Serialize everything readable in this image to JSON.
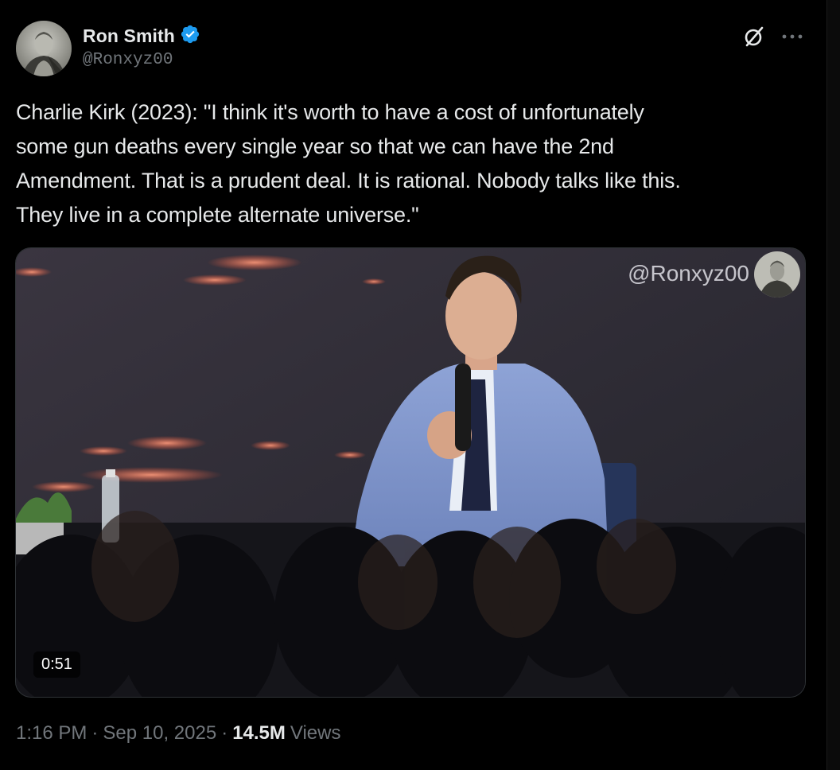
{
  "author": {
    "display_name": "Ron Smith",
    "handle": "@Ronxyz00",
    "verified": true,
    "verified_color": "#1d9bf0"
  },
  "actions": {
    "grok_icon": "grok-slash-circle-icon",
    "more_icon": "more-dots-icon"
  },
  "tweet": {
    "text": "Charlie Kirk (2023): \"I think it's worth to have a cost of unfortunately\nsome gun deaths every single year so that we can have the 2nd\nAmendment. That is a prudent deal. It is rational. Nobody talks like this.\nThey live in a complete alternate universe.\""
  },
  "media": {
    "watermark": "@Ronxyz00",
    "duration": "0:51"
  },
  "meta": {
    "time": "1:16 PM",
    "separator": "·",
    "date": "Sep 10, 2025",
    "views_count": "14.5M",
    "views_label": "Views"
  },
  "colors": {
    "background": "#000000",
    "text_primary": "#e7e9ea",
    "text_secondary": "#71767b",
    "border": "#2f3336"
  }
}
